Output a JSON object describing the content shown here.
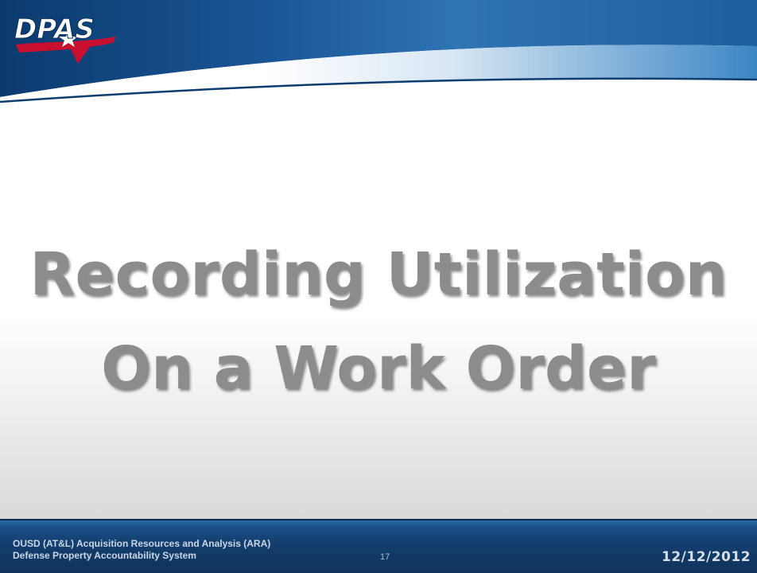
{
  "header": {
    "logo_text": "DPAS"
  },
  "main": {
    "title_line_1": "Recording Utilization",
    "title_line_2": "On a Work Order"
  },
  "footer": {
    "org_line_1": "OUSD (AT&L) Acquisition Resources and Analysis (ARA)",
    "org_line_2": "Defense Property Accountability System",
    "page_number": "17",
    "date": "12/12/2012"
  },
  "colors": {
    "banner_blue": "#1f5c99",
    "footer_blue": "#143f70",
    "title_gray": "#8c8c8c",
    "logo_red": "#c8102e"
  }
}
